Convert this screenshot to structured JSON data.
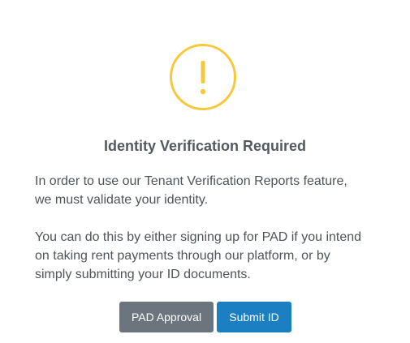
{
  "dialog": {
    "icon": "exclamation-icon",
    "icon_color": "#f6c83a",
    "title": "Identity Verification Required",
    "paragraph1_line1": "In order to use our Tenant Verification Reports feature,",
    "paragraph1_line2": "we must validate your identity.",
    "paragraph2_line1": "You can do this by either signing up for PAD if you intend",
    "paragraph2_line2": "on taking rent payments through our platform, or by",
    "paragraph2_line3": "simply submitting your ID documents."
  },
  "buttons": {
    "pad_label": "PAD Approval",
    "pad_color": "#6c757d",
    "submit_label": "Submit ID",
    "submit_color": "#1c7fc2"
  }
}
